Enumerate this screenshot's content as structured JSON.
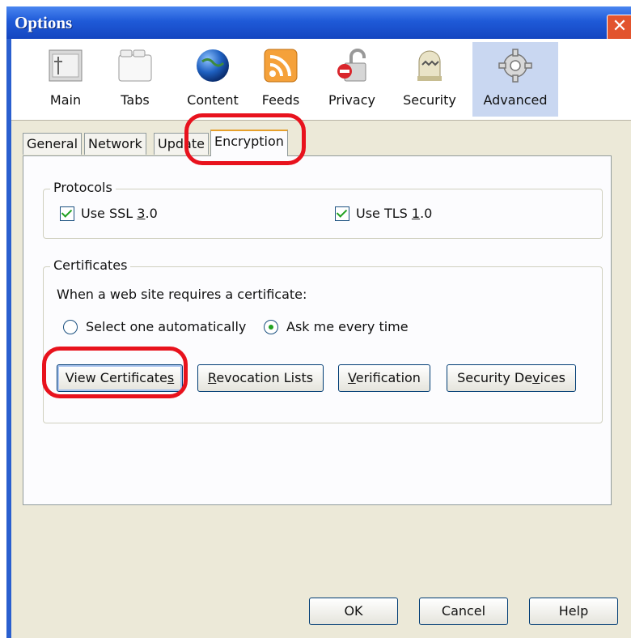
{
  "window": {
    "title": "Options",
    "close_symbol": "✕"
  },
  "panes": [
    {
      "label": "Main",
      "icon": "main-icon"
    },
    {
      "label": "Tabs",
      "icon": "tabs-icon"
    },
    {
      "label": "Content",
      "icon": "globe-icon"
    },
    {
      "label": "Feeds",
      "icon": "rss-icon"
    },
    {
      "label": "Privacy",
      "icon": "privacy-lock-icon"
    },
    {
      "label": "Security",
      "icon": "security-icon"
    },
    {
      "label": "Advanced",
      "icon": "gear-icon",
      "selected": true
    }
  ],
  "tabs": [
    {
      "label": "General"
    },
    {
      "label": "Network"
    },
    {
      "label": "Update"
    },
    {
      "label": "Encryption",
      "active": true
    }
  ],
  "protocols": {
    "legend": "Protocols",
    "ssl_pre": "Use SSL ",
    "ssl_u": "3",
    "ssl_post": ".0",
    "tls_pre": "Use TLS ",
    "tls_u": "1",
    "tls_post": ".0",
    "ssl_checked": true,
    "tls_checked": true
  },
  "certificates": {
    "legend": "Certificates",
    "prompt": "When a web site requires a certificate:",
    "opt_auto": "Select one automatically",
    "opt_ask": "Ask me every time",
    "selected": "Ask me every time"
  },
  "cert_buttons": {
    "view_pre": "View Certificate",
    "view_u": "s",
    "revocation_u": "R",
    "revocation_rest": "evocation Lists",
    "verification_u": "V",
    "verification_rest": "erification",
    "devices_pre": "Security De",
    "devices_u": "v",
    "devices_post": "ices"
  },
  "footer": {
    "ok": "OK",
    "cancel": "Cancel",
    "help": "Help"
  },
  "colors": {
    "highlight": "#e8121d",
    "titlebar": "#1f5ad8",
    "selected_pane": "#c9d7f1"
  }
}
